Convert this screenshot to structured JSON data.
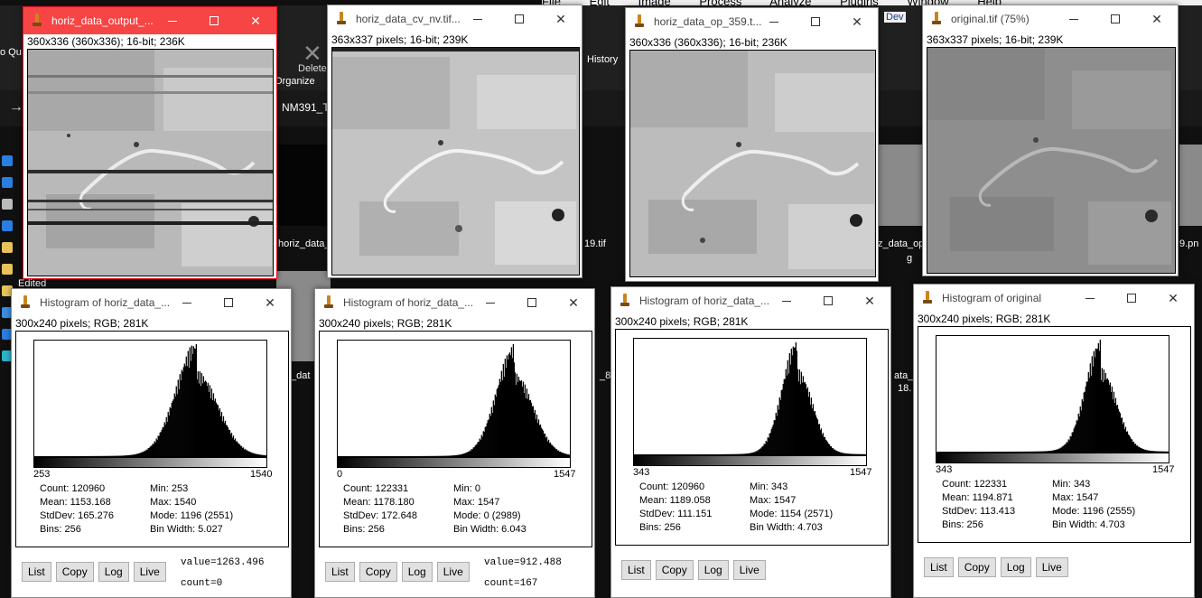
{
  "background": {
    "menu": [
      "File",
      "Edit",
      "Image",
      "Process",
      "Analyze",
      "Plugins",
      "Window",
      "Help"
    ],
    "toolbar": {
      "delete_label": "Delete",
      "organize_label": "Organize",
      "history_label": "History",
      "dev_label": "Dev",
      "quick_access_label": "o Qu ccess"
    },
    "address_path": "NM391_T",
    "file_labels": [
      "horiz_data_",
      "19.tif",
      "z_data_op",
      "g",
      "9.pn",
      "_dat",
      "_8",
      "ata_",
      "18.",
      "Edited"
    ],
    "accent_color": "#e81123"
  },
  "image_windows": [
    {
      "title": "horiz_data_output_...",
      "info": "360x336  (360x336); 16-bit; 236K",
      "active": true
    },
    {
      "title": "horiz_data_cv_nv.tif...",
      "info": "363x337 pixels; 16-bit; 239K",
      "active": false
    },
    {
      "title": "horiz_data_op_359.t...",
      "info": "360x336  (360x336); 16-bit; 236K",
      "active": false
    },
    {
      "title": "original.tif (75%)",
      "info": "363x337 pixels; 16-bit; 239K",
      "active": false
    }
  ],
  "histograms": [
    {
      "title": "Histogram of horiz_data_...",
      "info": "300x240 pixels; RGB; 281K",
      "range_min": "253",
      "range_max": "1540",
      "stats": {
        "count": "Count: 120960",
        "mean": "Mean: 1153.168",
        "stddev": "StdDev: 165.276",
        "bins": "Bins: 256",
        "min": "Min: 253",
        "max": "Max: 1540",
        "mode": "Mode: 1196 (2551)",
        "binwidth": "Bin Width: 5.027"
      },
      "value": "value=1263.496",
      "count": "count=0"
    },
    {
      "title": "Histogram of horiz_data_...",
      "info": "300x240 pixels; RGB; 281K",
      "range_min": "0",
      "range_max": "1547",
      "stats": {
        "count": "Count: 122331",
        "mean": "Mean: 1178.180",
        "stddev": "StdDev: 172.648",
        "bins": "Bins: 256",
        "min": "Min: 0",
        "max": "Max: 1547",
        "mode": "Mode: 0 (2989)",
        "binwidth": "Bin Width: 6.043"
      },
      "value": "value=912.488",
      "count": "count=167"
    },
    {
      "title": "Histogram of horiz_data_...",
      "info": "300x240 pixels; RGB; 281K",
      "range_min": "343",
      "range_max": "1547",
      "stats": {
        "count": "Count: 120960",
        "mean": "Mean: 1189.058",
        "stddev": "StdDev: 111.151",
        "bins": "Bins: 256",
        "min": "Min: 343",
        "max": "Max: 1547",
        "mode": "Mode: 1154 (2571)",
        "binwidth": "Bin Width: 4.703"
      },
      "value": "",
      "count": ""
    },
    {
      "title": "Histogram of original",
      "info": "300x240 pixels; RGB; 281K",
      "range_min": "343",
      "range_max": "1547",
      "stats": {
        "count": "Count: 122331",
        "mean": "Mean: 1194.871",
        "stddev": "StdDev: 113.413",
        "bins": "Bins: 256",
        "min": "Min: 343",
        "max": "Max: 1547",
        "mode": "Mode: 1196 (2555)",
        "binwidth": "Bin Width: 4.703"
      },
      "value": "",
      "count": ""
    }
  ],
  "buttons": {
    "list": "List",
    "copy": "Copy",
    "log": "Log",
    "live": "Live"
  }
}
